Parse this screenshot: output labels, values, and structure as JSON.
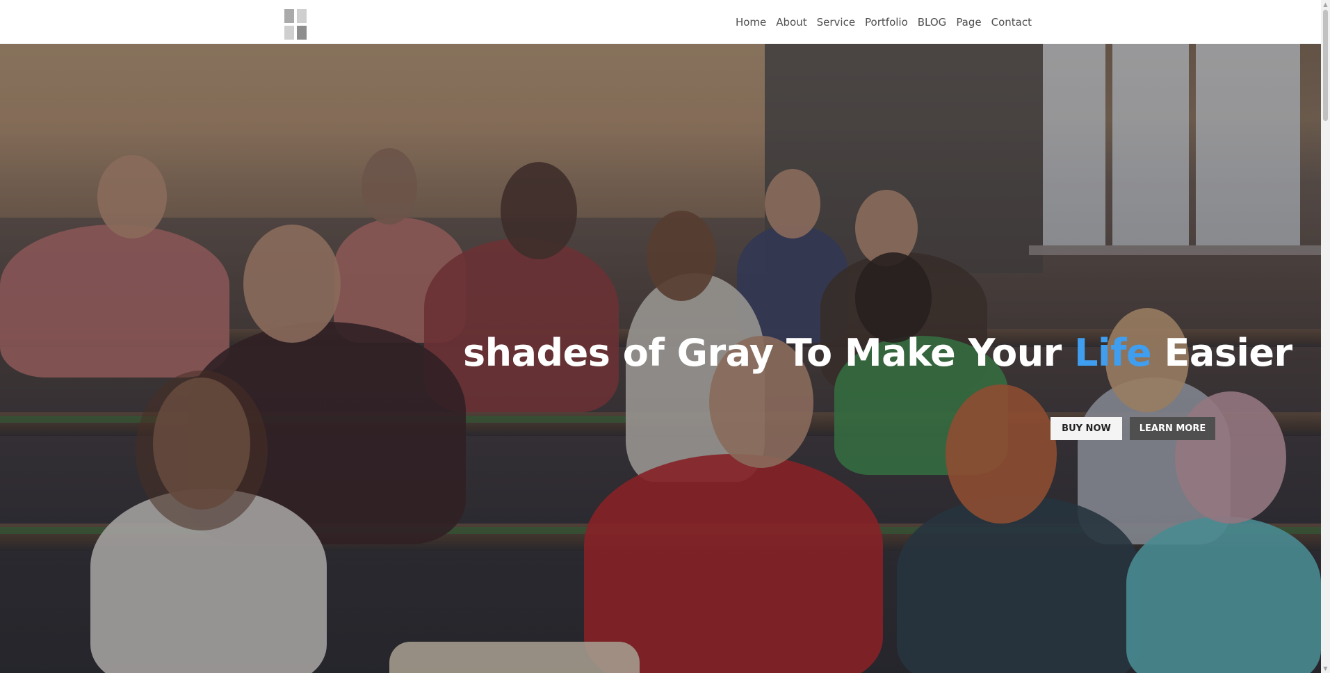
{
  "header": {
    "logo_icon": "grid-logo-icon",
    "nav": [
      {
        "label": "Home"
      },
      {
        "label": "About"
      },
      {
        "label": "Service"
      },
      {
        "label": "Portfolio"
      },
      {
        "label": "BLOG"
      },
      {
        "label": "Page"
      },
      {
        "label": "Contact"
      }
    ]
  },
  "hero": {
    "headline_part1": "shades of Gray To Make Your ",
    "headline_accent": "Life",
    "headline_part2": " Easier",
    "accent_color": "#3f9ef0",
    "background_image": "classroom-students-raising-hands",
    "buttons": {
      "buy_now": "BUY NOW",
      "learn_more": "LEARN MORE"
    }
  },
  "scrollbar": {
    "up_icon": "▲",
    "down_icon": "▼"
  }
}
